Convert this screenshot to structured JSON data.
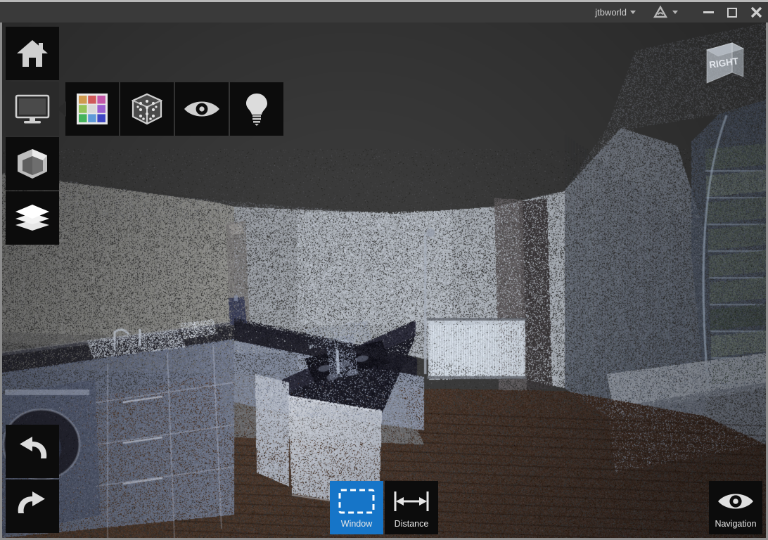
{
  "window": {
    "title_user": "jtbworld",
    "app_icon": "compass-icon",
    "minimize_label": "",
    "maximize_label": "",
    "close_label": ""
  },
  "viewcube": {
    "face_label": "RIGHT"
  },
  "toolbar_left": {
    "items": [
      {
        "name": "home-button",
        "icon": "home-icon",
        "label": ""
      },
      {
        "name": "display-button",
        "icon": "monitor-icon",
        "label": ""
      },
      {
        "name": "model-button",
        "icon": "cube-icon",
        "label": ""
      },
      {
        "name": "layers-button",
        "icon": "layers-icon",
        "label": ""
      }
    ]
  },
  "flyout": {
    "items": [
      {
        "name": "color-palette-button",
        "icon": "color-grid-icon",
        "label": ""
      },
      {
        "name": "point-cloud-button",
        "icon": "point-cube-icon",
        "label": ""
      },
      {
        "name": "visibility-button",
        "icon": "eye-icon",
        "label": ""
      },
      {
        "name": "lighting-button",
        "icon": "lightbulb-icon",
        "label": ""
      }
    ],
    "palette_colors": [
      "#cf9a4e",
      "#d05a5a",
      "#c357a8",
      "#94c45a",
      "#d8d8d8",
      "#9a5fd0",
      "#45b35b",
      "#5f9ad8",
      "#3d46c4"
    ]
  },
  "history": {
    "undo_label": "",
    "redo_label": ""
  },
  "modes": {
    "items": [
      {
        "name": "window-select-tool",
        "label": "Window",
        "icon": "marquee-icon",
        "active": true
      },
      {
        "name": "distance-measure-tool",
        "label": "Distance",
        "icon": "distance-icon",
        "active": false
      }
    ]
  },
  "navigation": {
    "label": "Navigation",
    "icon": "eye-icon"
  },
  "colors": {
    "accent": "#1675c8",
    "titlebar_bg": "#3a3a3a",
    "button_bg": "#0c0c0c",
    "frame": "#8e8e8e",
    "viewport_bg": "#3a3a3a",
    "background_strip": "#8ca04c"
  },
  "scene": {
    "type": "point-cloud",
    "subject": "kitchen-interior-laser-scan",
    "description": "Point cloud scan of a kitchen with L-shaped counter, island, washing machine, radiator, doorway and arched windows"
  }
}
